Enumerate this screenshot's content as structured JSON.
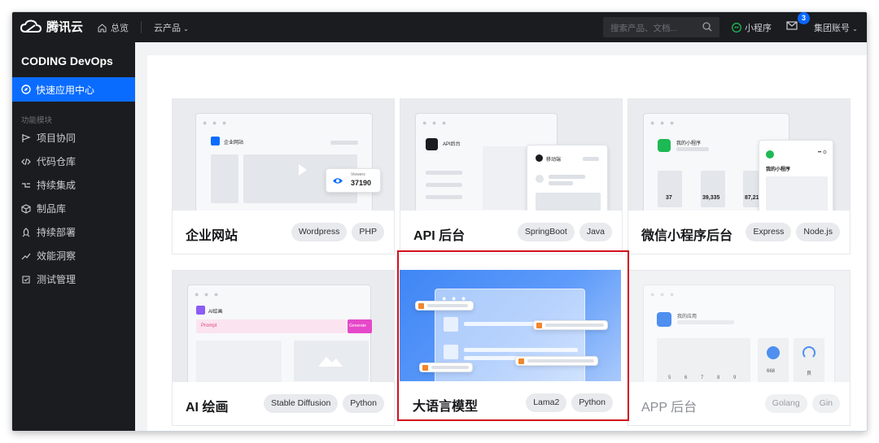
{
  "topbar": {
    "brand": "腾讯云",
    "home": "总览",
    "products": "云产品",
    "search_placeholder": "搜索产品、文档...",
    "miniprogram": "小程序",
    "mail_count": "3",
    "account": "集团账号"
  },
  "sidebar": {
    "brand": "CODING DevOps",
    "active": "快速应用中心",
    "group": "功能模块",
    "items": [
      "项目协同",
      "代码仓库",
      "持续集成",
      "制品库",
      "持续部署",
      "效能洞察",
      "测试管理"
    ]
  },
  "cards": [
    {
      "title": "企业网站",
      "tags": [
        "Wordpress",
        "PHP"
      ],
      "preview": {
        "label": "企业网站",
        "viewers_label": "Viewers",
        "viewers": "37190"
      }
    },
    {
      "title": "API 后台",
      "tags": [
        "SpringBoot",
        "Java"
      ],
      "preview": {
        "label": "API后台",
        "mobile": "移动端"
      }
    },
    {
      "title": "微信小程序后台",
      "tags": [
        "Express",
        "Node.js"
      ],
      "preview": {
        "label": "我的小程序",
        "panel_label": "我的小程序",
        "stats": [
          "37",
          "39,335",
          "87,21"
        ]
      }
    },
    {
      "title": "AI 绘画",
      "tags": [
        "Stable Diffusion",
        "Python"
      ],
      "preview": {
        "label": "AI绘画",
        "prompt": "Prompt",
        "generate": "Generate"
      }
    },
    {
      "title": "大语言模型",
      "tags": [
        "Lama2",
        "Python"
      ],
      "selected": true
    },
    {
      "title": "APP 后台",
      "tags": [
        "Golang",
        "Gin"
      ],
      "preview": {
        "label": "我的应用",
        "stat": "668",
        "stat2": "良",
        "xticks": [
          "5",
          "6",
          "7",
          "8",
          "9"
        ]
      },
      "dimmed": true
    }
  ],
  "colors": {
    "accent": "#0a6cff",
    "highlight": "#d2111d",
    "green": "#1db954"
  }
}
